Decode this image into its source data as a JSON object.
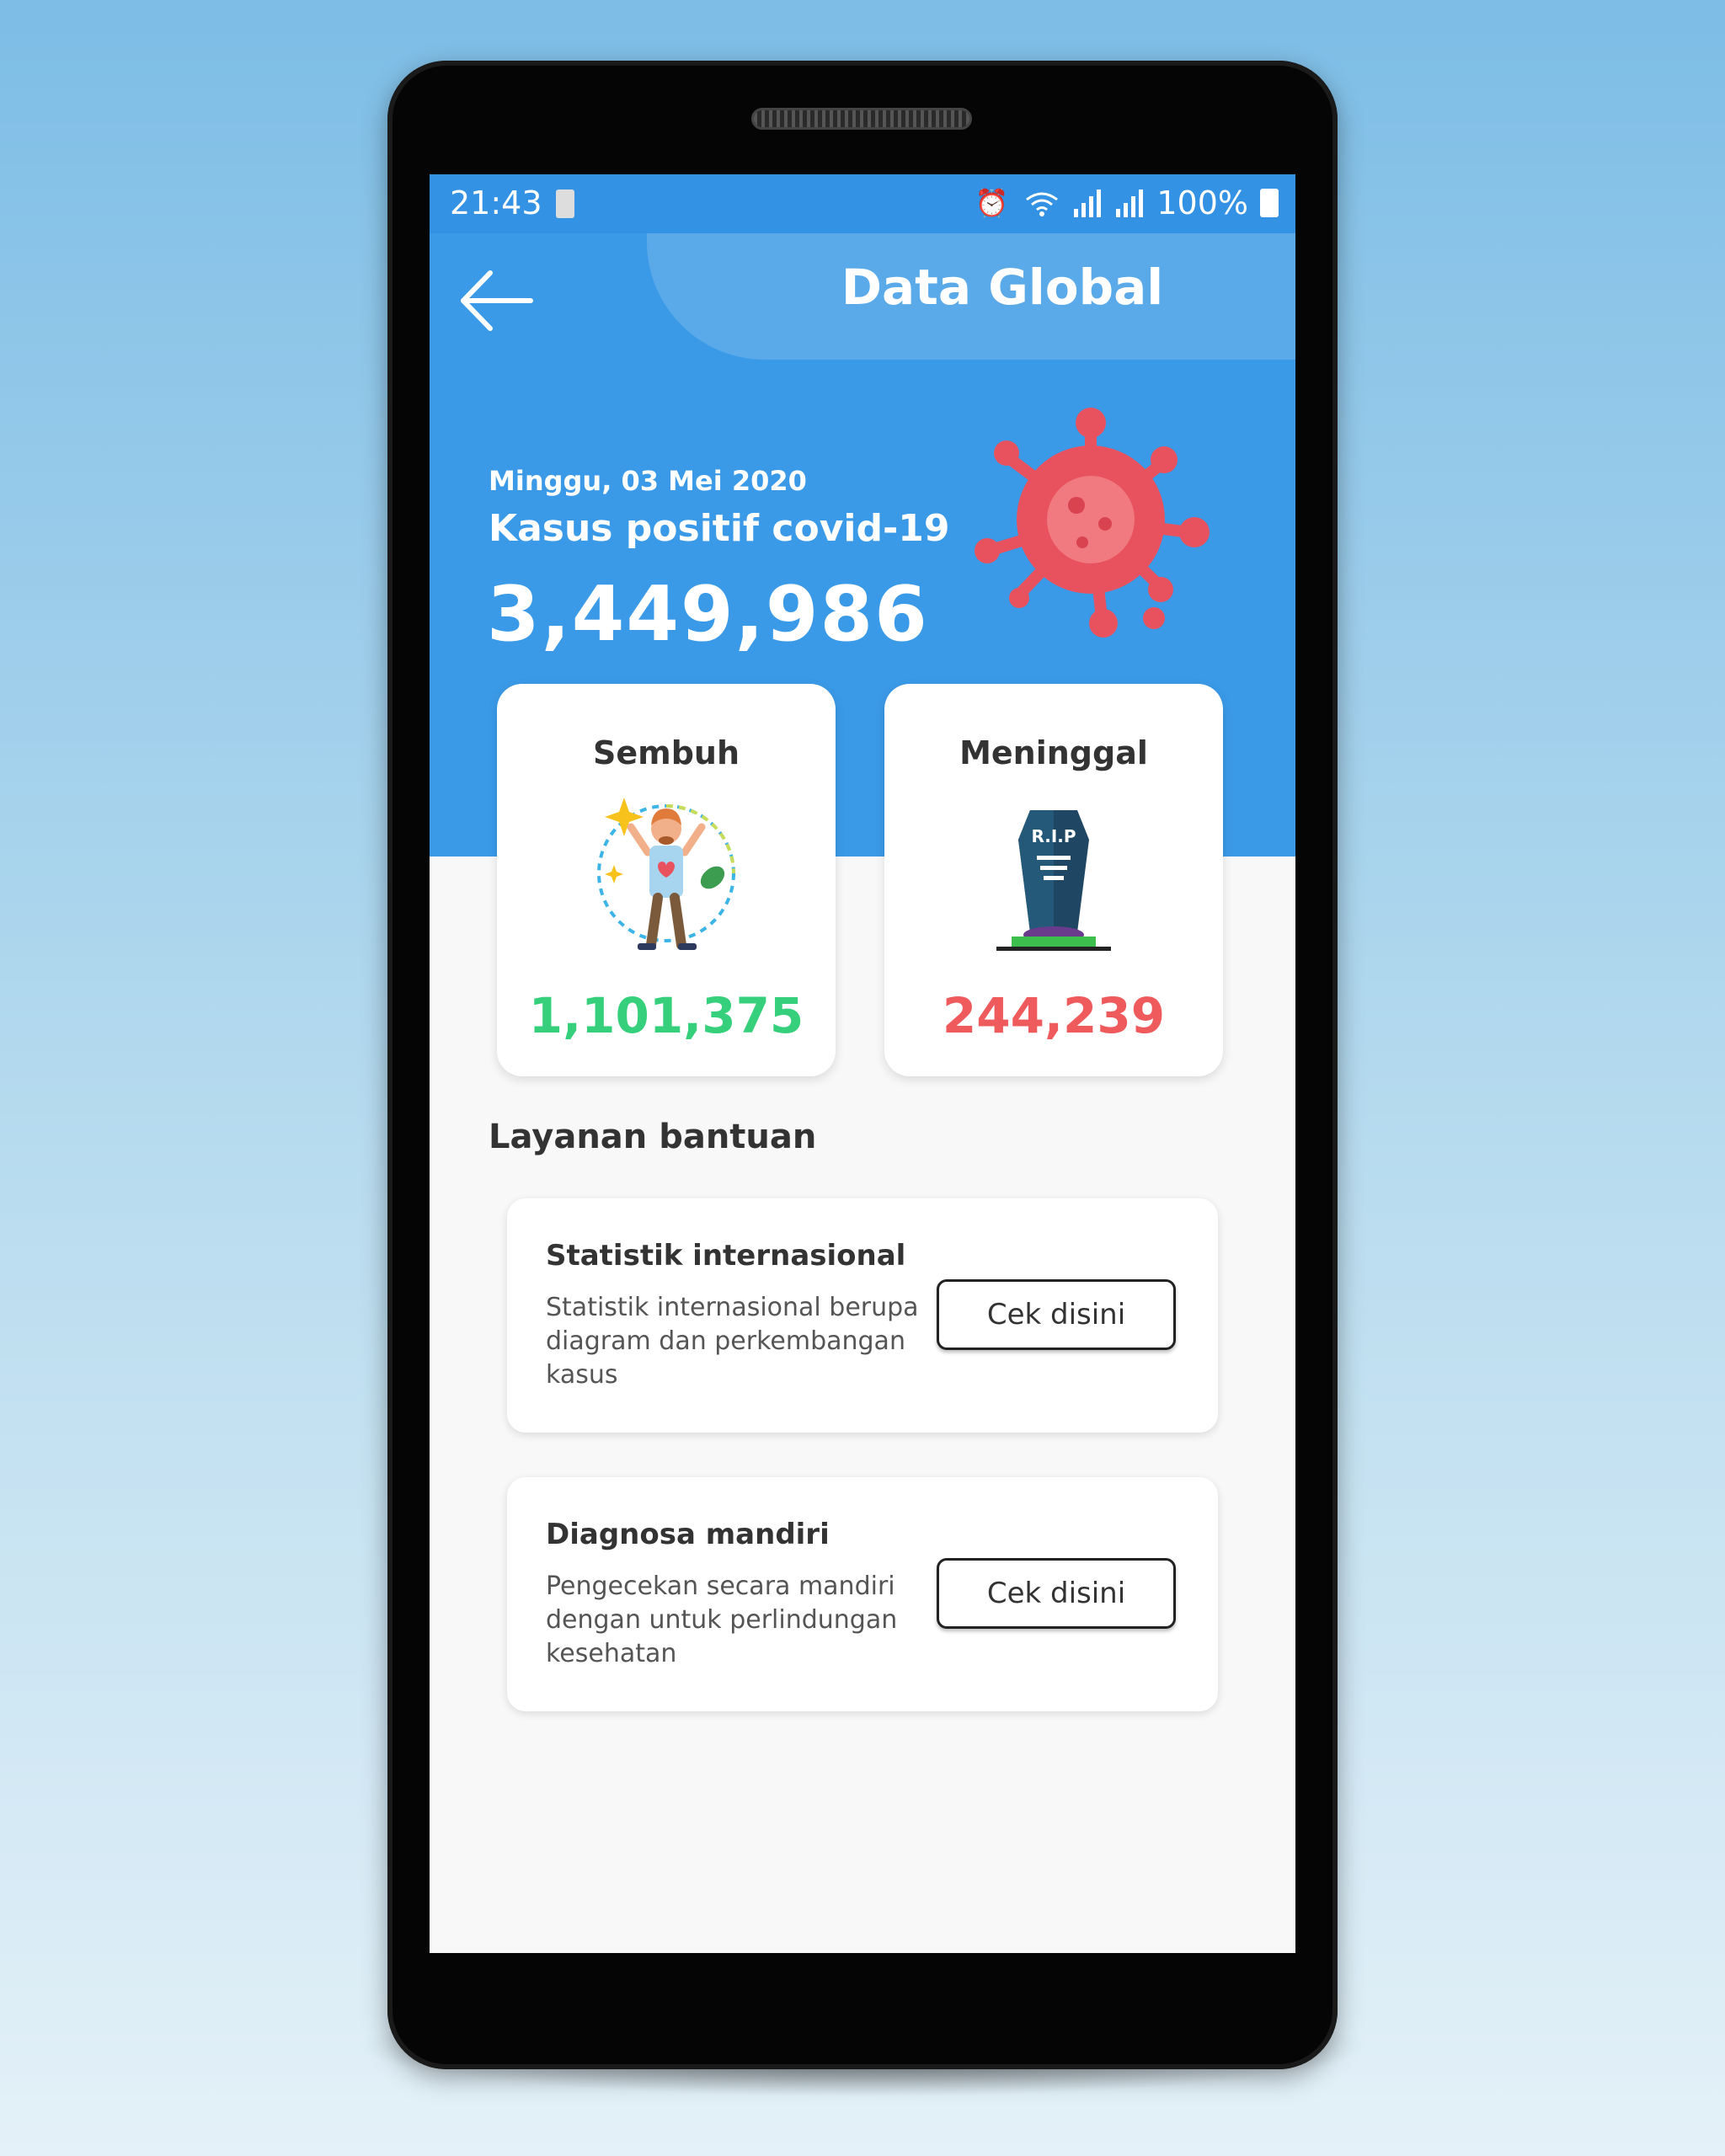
{
  "status_bar": {
    "time": "21:43",
    "battery_percent": "100%",
    "icons": [
      "alarm-icon",
      "wifi-icon",
      "signal-icon",
      "signal-icon",
      "battery-icon"
    ]
  },
  "header": {
    "title": "Data Global",
    "back_icon": "arrow-left-icon"
  },
  "summary": {
    "date": "Minggu, 03 Mei 2020",
    "label": "Kasus positif covid-19",
    "count": "3,449,986",
    "icon": "virus-icon"
  },
  "cards": {
    "recovered": {
      "title": "Sembuh",
      "value": "1,101,375",
      "icon": "recovered-person-icon",
      "color": "#36d07c"
    },
    "deaths": {
      "title": "Meninggal",
      "value": "244,239",
      "icon": "tombstone-icon",
      "tombstone_text": "R.I.P",
      "color": "#ef5a5d"
    }
  },
  "services": {
    "section_title": "Layanan bantuan",
    "items": [
      {
        "title": "Statistik internasional",
        "description": "Statistik internasional berupa diagram dan perkembangan kasus",
        "button": "Cek disini"
      },
      {
        "title": "Diagnosa mandiri",
        "description": "Pengecekan secara mandiri dengan untuk perlindungan kesehatan",
        "button": "Cek disini"
      }
    ]
  },
  "colors": {
    "primary": "#3a9ae8",
    "green": "#36d07c",
    "red": "#ef5a5d"
  }
}
